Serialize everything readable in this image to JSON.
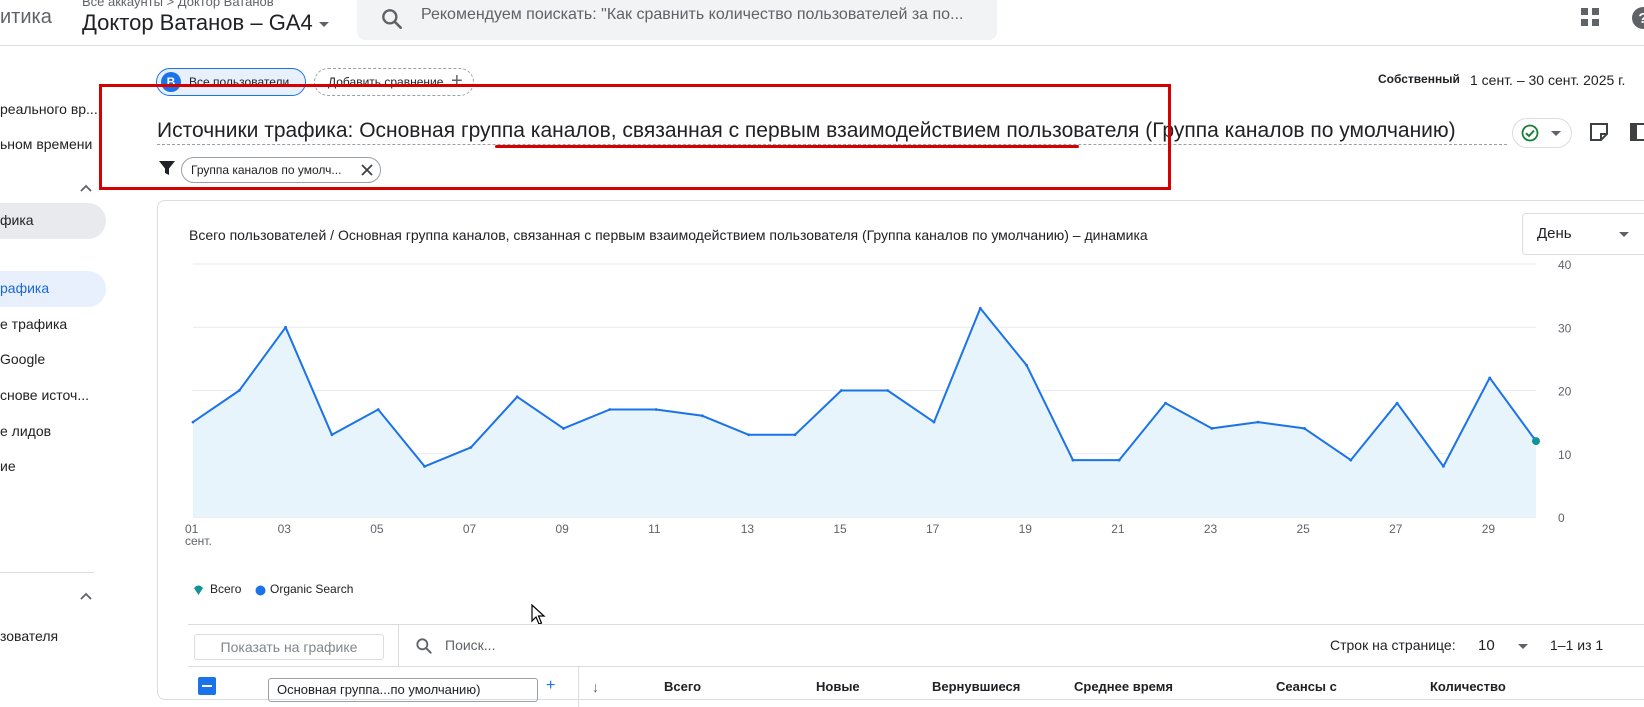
{
  "topbar": {
    "product": "итика",
    "breadcrumb": "Все аккаунты > Доктор Ватанов",
    "property": "Доктор Ватанов – GA4",
    "search_placeholder": "Рекомендуем поискать: \"Как сравнить количество пользователей за по..."
  },
  "sidebar": {
    "items": [
      {
        "label": "реального вр..."
      },
      {
        "label": "ьном времени"
      },
      {
        "label": "фика"
      },
      {
        "label": "рафика"
      },
      {
        "label": "е трафика"
      },
      {
        "label": "Google"
      },
      {
        "label": "снове источ..."
      },
      {
        "label": "е лидов"
      },
      {
        "label": "ие"
      },
      {
        "label": "зователя"
      }
    ]
  },
  "comparison": {
    "segment_avatar": "B",
    "segment_label": "Все пользователи",
    "add_comparison": "Добавить сравнение",
    "date_type": "Собственный",
    "date_range": "1 сент. – 30 сент. 2025 г."
  },
  "report": {
    "title": "Источники трафика: Основная группа каналов, связанная с первым взаимодействием пользователя (Группа каналов по умолчанию)",
    "filter_label": "Группа каналов по умолч..."
  },
  "chart_card": {
    "title": "Всего пользователей / Основная группа каналов, связанная с первым взаимодействием пользователя (Группа каналов по умолчанию) – динамика",
    "period": "День"
  },
  "chart_data": {
    "type": "area",
    "x": [
      1,
      2,
      3,
      4,
      5,
      6,
      7,
      8,
      9,
      10,
      11,
      12,
      13,
      14,
      15,
      16,
      17,
      18,
      19,
      20,
      21,
      22,
      23,
      24,
      25,
      26,
      27,
      28,
      29,
      30
    ],
    "x_ticks": [
      "01",
      "03",
      "05",
      "07",
      "09",
      "11",
      "13",
      "15",
      "17",
      "19",
      "21",
      "23",
      "25",
      "27",
      "29"
    ],
    "x_first_sublabel": "сент.",
    "y_ticks": [
      "40",
      "30",
      "20",
      "10",
      "0"
    ],
    "ylim": [
      0,
      40
    ],
    "grid": true,
    "series": [
      {
        "name": "Organic Search",
        "values": [
          15,
          20,
          30,
          13,
          17,
          8,
          11,
          19,
          14,
          17,
          17,
          16,
          13,
          13,
          20,
          20,
          15,
          33,
          24,
          9,
          9,
          18,
          14,
          15,
          14,
          9,
          18,
          8,
          22,
          12
        ]
      }
    ],
    "legend": [
      "Всего",
      "Organic Search"
    ],
    "legend_position": "bottom-left",
    "colors": {
      "line": "#1a73e8",
      "fill": "#e8f4fc",
      "total": "#12939a"
    }
  },
  "table": {
    "show_chart": "Показать на графике",
    "search_placeholder": "Поиск...",
    "rows_label": "Строк на странице:",
    "rows_value": "10",
    "pagination": "1–1 из 1",
    "dimension": "Основная группа...по умолчанию)",
    "columns": [
      "Всего",
      "Новые",
      "Вернувшиеся",
      "Среднее время",
      "Сеансы с",
      "Количество"
    ]
  }
}
